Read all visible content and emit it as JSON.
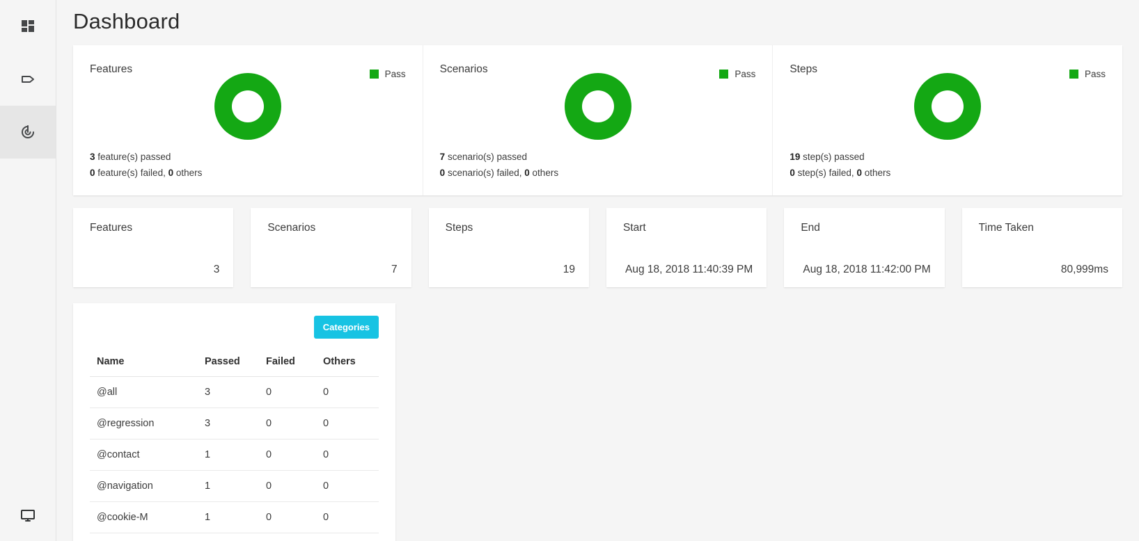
{
  "colors": {
    "pass_green": "#14a814",
    "categories_button": "#17c3e3",
    "sidebar_active_bg": "#e6e6e6",
    "page_bg": "#f5f5f5",
    "card_bg": "#ffffff"
  },
  "sidebar": {
    "items": [
      {
        "icon": "grid-dashboard-icon",
        "name": "sidebar-item-overview",
        "active": false
      },
      {
        "icon": "tag-icon",
        "name": "sidebar-item-tags",
        "active": false
      },
      {
        "icon": "target-power-icon",
        "name": "sidebar-item-trends",
        "active": true
      }
    ],
    "bottom_item": {
      "icon": "monitor-icon",
      "name": "sidebar-item-display"
    }
  },
  "header": {
    "title": "Dashboard"
  },
  "donut_cards": [
    {
      "title": "Features",
      "legend_label": "Pass",
      "passed_count": "3",
      "passed_text": "feature(s) passed",
      "failed_count": "0",
      "failed_text": "feature(s) failed,",
      "others_count": "0",
      "others_text": "others"
    },
    {
      "title": "Scenarios",
      "legend_label": "Pass",
      "passed_count": "7",
      "passed_text": "scenario(s) passed",
      "failed_count": "0",
      "failed_text": "scenario(s) failed,",
      "others_count": "0",
      "others_text": "others"
    },
    {
      "title": "Steps",
      "legend_label": "Pass",
      "passed_count": "19",
      "passed_text": "step(s) passed",
      "failed_count": "0",
      "failed_text": "step(s) failed,",
      "others_count": "0",
      "others_text": "others"
    }
  ],
  "stat_cards": [
    {
      "label": "Features",
      "value": "3"
    },
    {
      "label": "Scenarios",
      "value": "7"
    },
    {
      "label": "Steps",
      "value": "19"
    },
    {
      "label": "Start",
      "value": "Aug 18, 2018 11:40:39 PM"
    },
    {
      "label": "End",
      "value": "Aug 18, 2018 11:42:00 PM"
    },
    {
      "label": "Time Taken",
      "value": "80,999ms"
    }
  ],
  "categories": {
    "button_label": "Categories",
    "columns": [
      "Name",
      "Passed",
      "Failed",
      "Others"
    ],
    "rows": [
      {
        "name": "@all",
        "passed": "3",
        "failed": "0",
        "others": "0"
      },
      {
        "name": "@regression",
        "passed": "3",
        "failed": "0",
        "others": "0"
      },
      {
        "name": "@contact",
        "passed": "1",
        "failed": "0",
        "others": "0"
      },
      {
        "name": "@navigation",
        "passed": "1",
        "failed": "0",
        "others": "0"
      },
      {
        "name": "@cookie-M",
        "passed": "1",
        "failed": "0",
        "others": "0"
      }
    ]
  },
  "chart_data": [
    {
      "type": "pie",
      "title": "Features",
      "labels": [
        "Pass"
      ],
      "values": [
        3
      ],
      "colors": [
        "#14a814"
      ],
      "legend_position": "top-right",
      "donut": true
    },
    {
      "type": "pie",
      "title": "Scenarios",
      "labels": [
        "Pass"
      ],
      "values": [
        7
      ],
      "colors": [
        "#14a814"
      ],
      "legend_position": "top-right",
      "donut": true
    },
    {
      "type": "pie",
      "title": "Steps",
      "labels": [
        "Pass"
      ],
      "values": [
        19
      ],
      "colors": [
        "#14a814"
      ],
      "legend_position": "top-right",
      "donut": true
    }
  ]
}
